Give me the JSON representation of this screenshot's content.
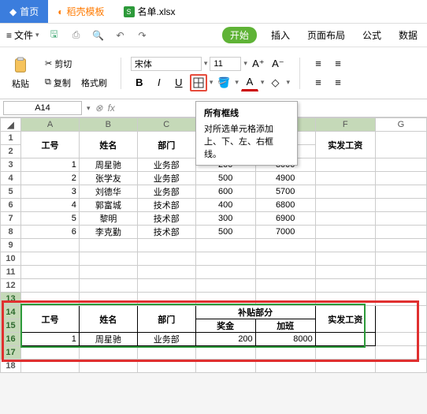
{
  "tabs": [
    {
      "label": "首页",
      "color": "#3b7ddd"
    },
    {
      "label": "稻壳模板",
      "color": "#ff7a00"
    },
    {
      "label": "名单.xlsx",
      "color": "#2d9a3a"
    }
  ],
  "file_menu": "文件",
  "ribbon_tabs": [
    "开始",
    "插入",
    "页面布局",
    "公式",
    "数据"
  ],
  "ribbon": {
    "paste": "粘贴",
    "cut": "剪切",
    "copy": "复制",
    "format_painter": "格式刷",
    "font_name": "宋体",
    "font_size": "11",
    "bold": "B",
    "italic": "I",
    "underline": "U"
  },
  "namebox": "A14",
  "fx": "fx",
  "tooltip": {
    "title": "所有框线",
    "body": "对所选单元格添加上、下、左、右框线。"
  },
  "columns": [
    "A",
    "B",
    "C",
    "D",
    "E",
    "F",
    "G"
  ],
  "headers": {
    "empno": "工号",
    "name": "姓名",
    "dept": "部门",
    "subsidy": "补贴部分",
    "bonus": "奖金",
    "overtime": "加班",
    "netpay": "实发工资"
  },
  "rows": [
    {
      "n": 1,
      "no": "1",
      "name": "周星驰",
      "dept": "业务部",
      "bonus": "200",
      "ot": "8000"
    },
    {
      "n": 2,
      "no": "2",
      "name": "张学友",
      "dept": "业务部",
      "bonus": "500",
      "ot": "4900"
    },
    {
      "n": 3,
      "no": "3",
      "name": "刘德华",
      "dept": "业务部",
      "bonus": "600",
      "ot": "5700"
    },
    {
      "n": 4,
      "no": "4",
      "name": "郭富城",
      "dept": "技术部",
      "bonus": "400",
      "ot": "6800"
    },
    {
      "n": 5,
      "no": "5",
      "name": "黎明",
      "dept": "技术部",
      "bonus": "300",
      "ot": "6900"
    },
    {
      "n": 6,
      "no": "6",
      "name": "李克勤",
      "dept": "技术部",
      "bonus": "500",
      "ot": "7000"
    }
  ],
  "sample": {
    "no": "1",
    "name": "周星驰",
    "dept": "业务部",
    "bonus": "200",
    "ot": "8000"
  }
}
